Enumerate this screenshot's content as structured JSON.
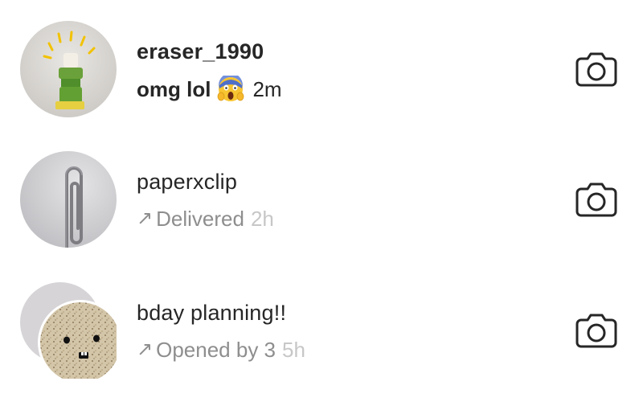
{
  "conversations": [
    {
      "name": "eraser_1990",
      "message": "omg lol",
      "emoji": "😱",
      "time": "2m",
      "unread": true,
      "avatar_icon": "eraser-pencil-icon",
      "action_icon": "camera-icon"
    },
    {
      "name": "paperxclip",
      "arrow": "↗",
      "status": "Delivered",
      "time": "2h",
      "unread": false,
      "avatar_icon": "paperclip-icon",
      "action_icon": "camera-icon"
    },
    {
      "name": "bday planning!!",
      "arrow": "↗",
      "status": "Opened by 3",
      "time": "5h",
      "unread": false,
      "avatar_icon": "group-cork-face-icon",
      "action_icon": "camera-icon"
    }
  ],
  "colors": {
    "primary_text": "#262626",
    "secondary_text": "#8e8e8e",
    "tertiary_text": "#c7c7c7",
    "icon_stroke": "#262626",
    "background": "#ffffff"
  }
}
